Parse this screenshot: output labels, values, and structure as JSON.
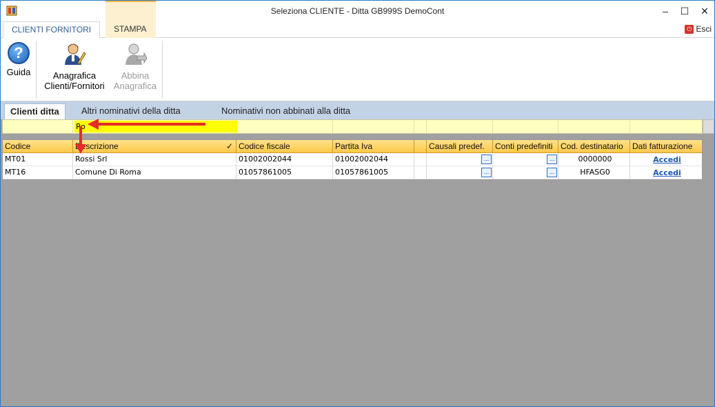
{
  "window": {
    "title": "Seleziona CLIENTE  - Ditta GB999S DemoCont",
    "controls": {
      "minimize": "–",
      "maximize": "☐",
      "close": "✕"
    }
  },
  "ribbon": {
    "tabs": [
      {
        "label": "CLIENTI FORNITORI",
        "active": true
      },
      {
        "label": "STAMPA",
        "active": false
      }
    ],
    "exit_label": "Esci",
    "buttons": [
      {
        "label_line1": "Guida",
        "label_line2": "",
        "enabled": true,
        "icon": "help-icon"
      },
      {
        "label_line1": "Anagrafica",
        "label_line2": "Clienti/Fornitori",
        "enabled": true,
        "icon": "person-edit-icon"
      },
      {
        "label_line1": "Abbina",
        "label_line2": "Anagrafica",
        "enabled": false,
        "icon": "person-link-icon"
      }
    ]
  },
  "inner_tabs": [
    {
      "label": "Clienti ditta",
      "active": true
    },
    {
      "label": "Altri nominativi della ditta",
      "active": false
    },
    {
      "label": "Nominativi non abbinati alla ditta",
      "active": false
    }
  ],
  "filter": {
    "descrizione_value": "Ro"
  },
  "grid": {
    "columns": [
      "Codice",
      "Descrizione",
      "Codice fiscale",
      "Partita Iva",
      "",
      "Causali predef.",
      "Conti predefiniti",
      "Cod. destinatario",
      "Dati fatturazione"
    ],
    "sort_indicator": "✓",
    "rows": [
      {
        "codice": "MT01",
        "descrizione": "Rossi Srl",
        "codice_fiscale": "01002002044",
        "partita_iva": "01002002044",
        "causali": "...",
        "conti": "...",
        "cod_destinatario": "0000000",
        "dati_fatturazione": "Accedi"
      },
      {
        "codice": "MT16",
        "descrizione": "Comune Di Roma",
        "codice_fiscale": "01057861005",
        "partita_iva": "01057861005",
        "causali": "...",
        "conti": "...",
        "cod_destinatario": "HFASG0",
        "dati_fatturazione": "Accedi"
      }
    ]
  },
  "colors": {
    "accent": "#2b79c2",
    "header_yellow": "#fcc94a",
    "filter_yellow": "#ffffc0",
    "annotation_red": "#e52b2b",
    "grid_background": "#a0a0a0"
  }
}
